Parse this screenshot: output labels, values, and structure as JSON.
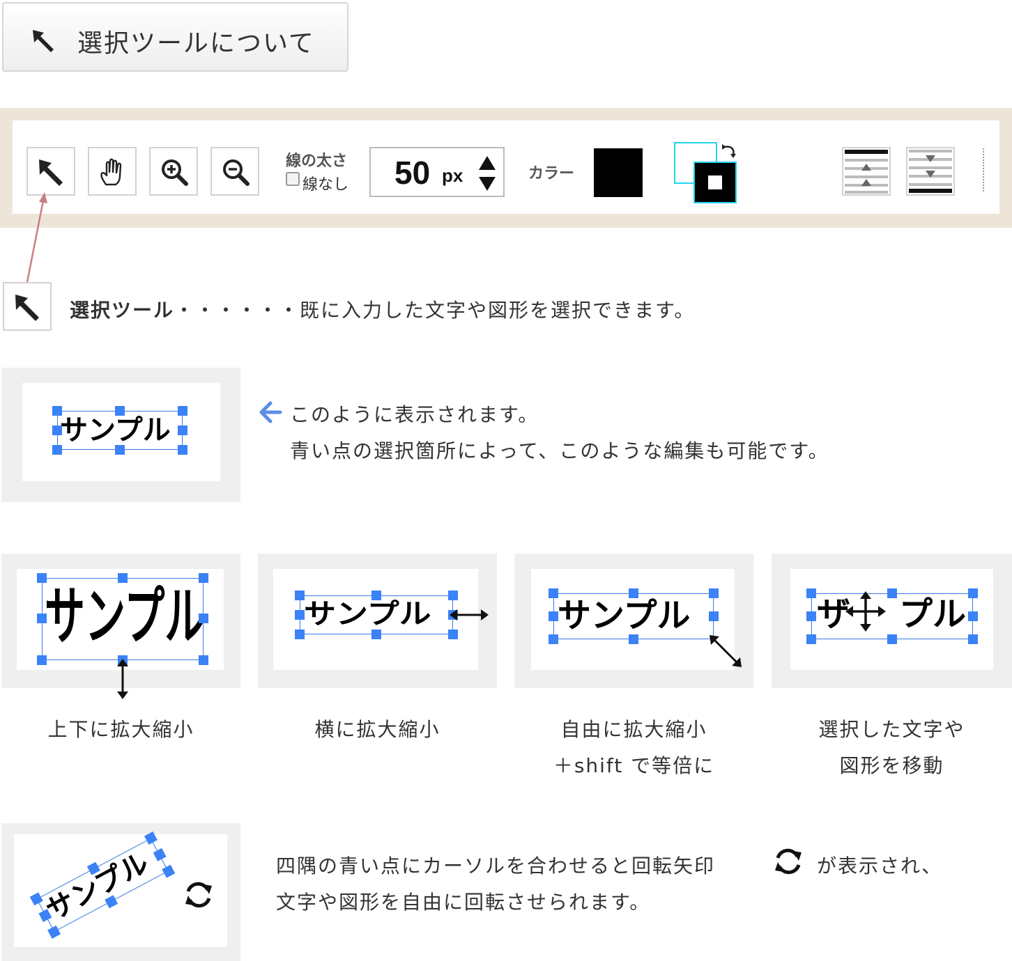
{
  "heading": {
    "title": "選択ツールについて",
    "icon": "cursor-arrow-icon"
  },
  "toolbar": {
    "tools": [
      {
        "name": "select-tool",
        "icon": "cursor-arrow-icon"
      },
      {
        "name": "hand-tool",
        "icon": "hand-icon"
      },
      {
        "name": "zoom-in-tool",
        "icon": "zoom-in-icon"
      },
      {
        "name": "zoom-out-tool",
        "icon": "zoom-out-icon"
      }
    ],
    "line_width_label": "線の太さ",
    "no_line_label": "線なし",
    "size_value": "50",
    "size_unit": "px",
    "color_label": "カラー",
    "color_value": "#000000",
    "stroke_color": "#22d3ee"
  },
  "select_tool": {
    "name": "選択ツール",
    "dots": "・・・・・・",
    "description": "既に入力した文字や図形を選択できます。"
  },
  "sample_text": "サンプル",
  "move_sample_text": "ザ",
  "move_sample_rest": "プル",
  "info": {
    "line1": "このように表示されます。",
    "line2": "青い点の選択箇所によって、このような編集も可能です。"
  },
  "captions": {
    "vertical": "上下に拡大縮小",
    "horizontal": "横に拡大縮小",
    "free_line1": "自由に拡大縮小",
    "free_line2": "＋shift で等倍に",
    "move_line1": "選択した文字や",
    "move_line2": "図形を移動"
  },
  "rotate": {
    "text1": "四隅の青い点にカーソルを合わせると回転矢印",
    "text2": "が表示され、",
    "text3": "文字や図形を自由に回転させられます。"
  },
  "colors": {
    "handle": "#3b82f6",
    "accent": "#5b8ee6",
    "toolbar_frame": "#eee5d9",
    "panel": "#efefef"
  }
}
